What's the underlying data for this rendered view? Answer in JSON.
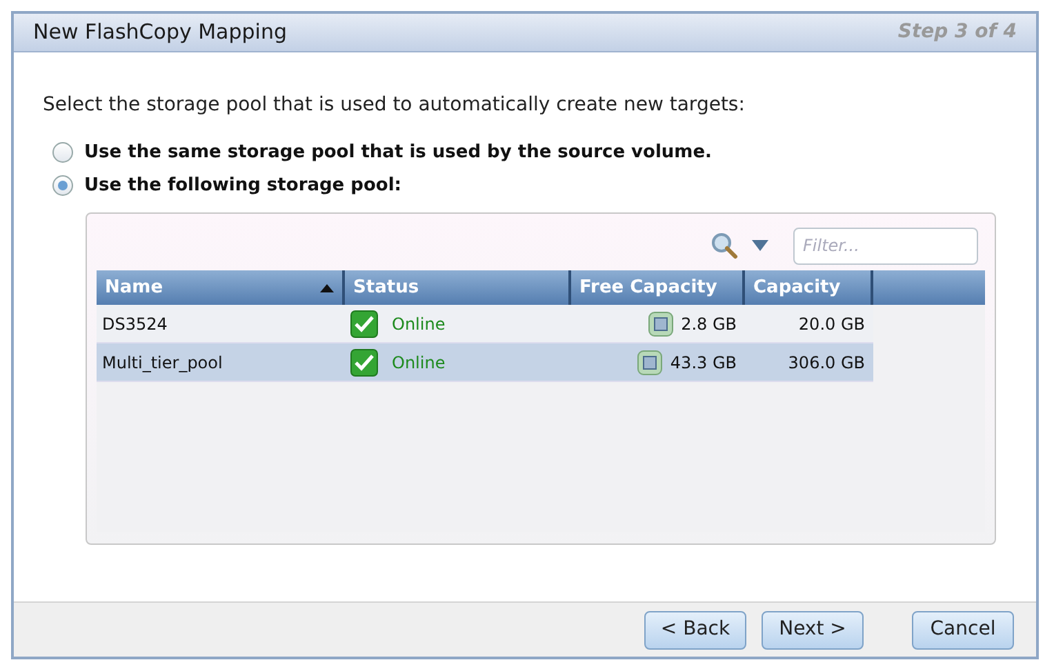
{
  "window": {
    "title": "New FlashCopy Mapping",
    "step": "Step 3 of 4"
  },
  "instruction": "Select the storage pool that is used to automatically create new targets:",
  "options": [
    {
      "label": "Use the same storage pool that is used by the source volume.",
      "selected": false
    },
    {
      "label": "Use the following storage pool:",
      "selected": true
    }
  ],
  "filter": {
    "placeholder": "Filter..."
  },
  "table": {
    "columns": [
      {
        "label": "Name",
        "sorted": true
      },
      {
        "label": "Status",
        "sorted": false
      },
      {
        "label": "Free Capacity",
        "sorted": false
      },
      {
        "label": "Capacity",
        "sorted": false
      }
    ],
    "rows": [
      {
        "name": "DS3524",
        "status": "Online",
        "free": "2.8 GB",
        "capacity": "20.0 GB",
        "selected": false
      },
      {
        "name": "Multi_tier_pool",
        "status": "Online",
        "free": "43.3 GB",
        "capacity": "306.0 GB",
        "selected": true
      }
    ]
  },
  "buttons": [
    "< Back",
    "Next >",
    "Cancel"
  ]
}
